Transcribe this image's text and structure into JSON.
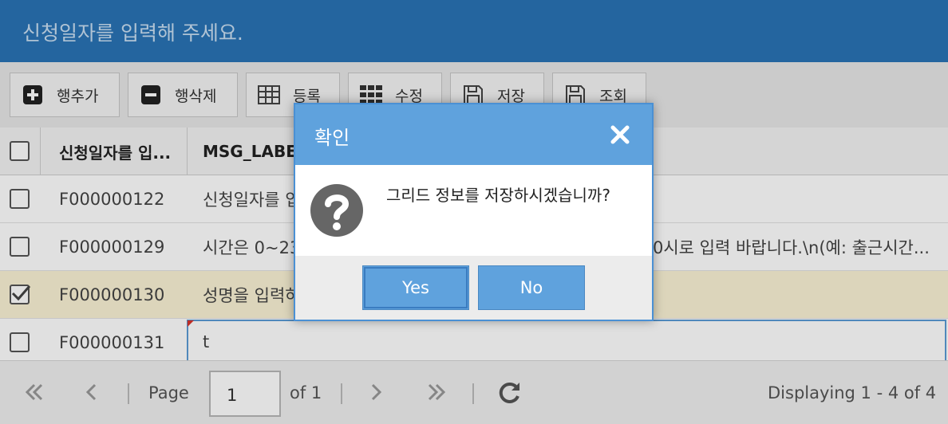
{
  "header": {
    "title": "신청일자를 입력해 주세요."
  },
  "toolbar": {
    "buttons": [
      {
        "label": "행추가",
        "icon": "plus-square-icon"
      },
      {
        "label": "행삭제",
        "icon": "minus-square-icon"
      },
      {
        "label": "등록",
        "icon": "table-icon"
      },
      {
        "label": "수정",
        "icon": "grid-icon"
      },
      {
        "label": "저장",
        "icon": "save-icon"
      },
      {
        "label": "조회",
        "icon": "save-icon"
      }
    ]
  },
  "grid": {
    "columns": [
      "신청일자를 입...",
      "MSG_LABE"
    ],
    "rows": [
      {
        "id": "F000000122",
        "msg": "신청일자를 입",
        "checked": false
      },
      {
        "id": "F000000129",
        "msg": "시간은 0~23",
        "msg_tail": "0시로 입력 바랍니다.\\n(예: 출근시간...",
        "checked": false
      },
      {
        "id": "F000000130",
        "msg": "성명을 입력하",
        "checked": true
      },
      {
        "id": "F000000131",
        "msg": "t",
        "checked": false
      }
    ]
  },
  "pager": {
    "page_label": "Page",
    "page_value": "1",
    "of_label": "of 1",
    "display_text": "Displaying 1 - 4 of 4"
  },
  "dialog": {
    "title": "확인",
    "message": "그리드 정보를 저장하시겠습니까?",
    "yes_label": "Yes",
    "no_label": "No"
  },
  "colors": {
    "header": "#2a74b6",
    "dialog_title": "#5fa2dd",
    "selected_row": "#fbf3d5"
  }
}
